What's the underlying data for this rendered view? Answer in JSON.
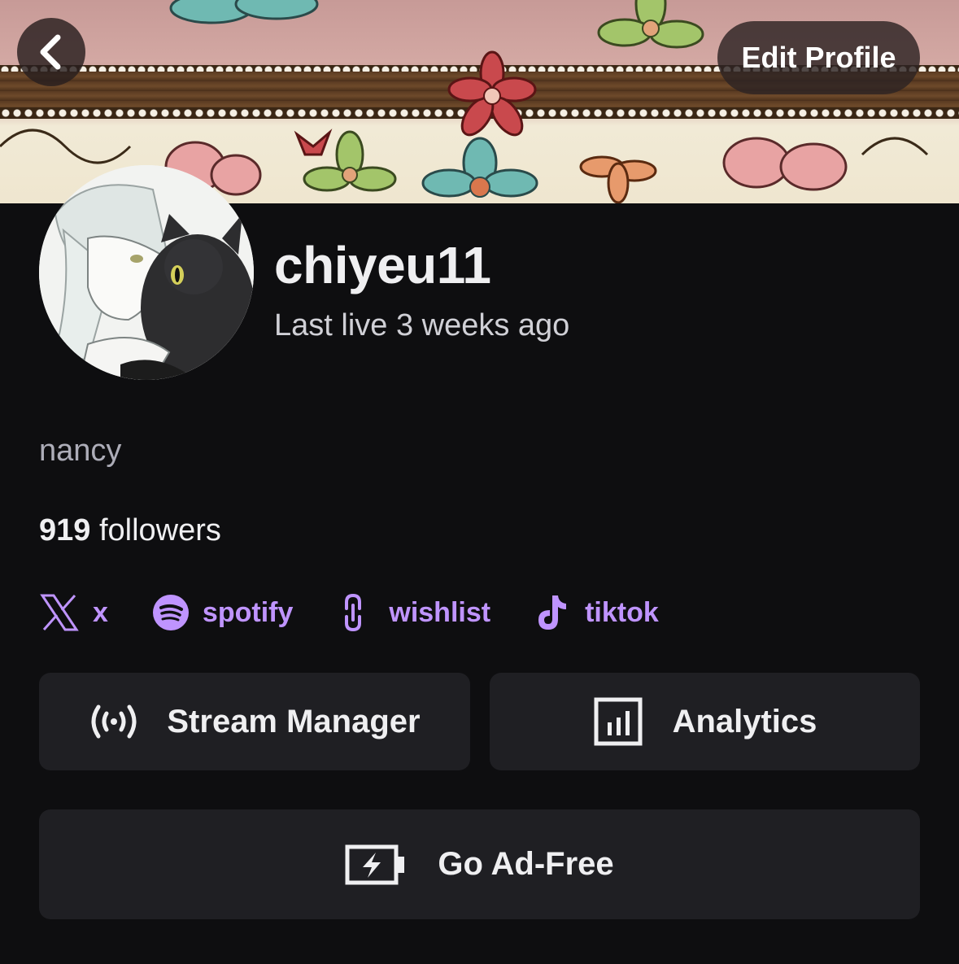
{
  "header": {
    "back_icon": "chevron-left-icon",
    "edit_profile_label": "Edit Profile"
  },
  "profile": {
    "username": "chiyeu11",
    "last_live": "Last live 3 weeks ago",
    "bio": "nancy",
    "followers_count": "919",
    "followers_label": "followers"
  },
  "links": [
    {
      "label": "x",
      "icon": "x-logo-icon"
    },
    {
      "label": "spotify",
      "icon": "spotify-icon"
    },
    {
      "label": "wishlist",
      "icon": "link-icon"
    },
    {
      "label": "tiktok",
      "icon": "tiktok-icon"
    }
  ],
  "actions": {
    "stream_manager": {
      "label": "Stream Manager",
      "icon": "broadcast-icon"
    },
    "analytics": {
      "label": "Analytics",
      "icon": "analytics-icon"
    },
    "ad_free": {
      "label": "Go Ad-Free",
      "icon": "battery-bolt-icon"
    }
  },
  "colors": {
    "background": "#0e0e10",
    "accent_link": "#bf94ff",
    "button_bg": "#1f1f23",
    "text_primary": "#efeff1",
    "text_secondary": "#adadb8"
  }
}
